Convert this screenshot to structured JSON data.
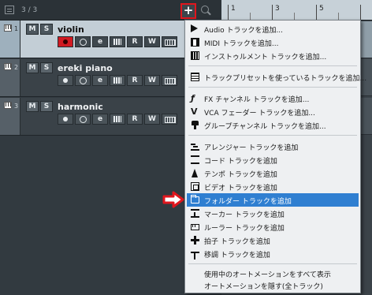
{
  "tracklist": {
    "count": "3 / 3",
    "add_button": "+",
    "tracks": [
      {
        "num": "1",
        "name": "violin",
        "m": "M",
        "s": "S",
        "btn_e": "e",
        "btn_r": "R",
        "btn_w": "W"
      },
      {
        "num": "2",
        "name": "ereki piano",
        "m": "M",
        "s": "S",
        "btn_e": "e",
        "btn_r": "R",
        "btn_w": "W"
      },
      {
        "num": "3",
        "name": "harmonic",
        "m": "M",
        "s": "S",
        "btn_e": "e",
        "btn_r": "R",
        "btn_w": "W"
      }
    ]
  },
  "ruler": {
    "bars": [
      "1",
      "3",
      "5"
    ]
  },
  "menu": {
    "items": [
      {
        "label": "Audio トラックを追加...",
        "icon": "audio-icon"
      },
      {
        "label": "MIDI トラックを追加...",
        "icon": "midi-icon"
      },
      {
        "label": "インストゥルメント トラックを追加...",
        "icon": "instrument-icon"
      },
      {
        "label": "トラックプリセットを使っているトラックを追加...",
        "icon": "preset-icon"
      },
      {
        "label": "FX チャンネル トラックを追加...",
        "icon": "fx-icon"
      },
      {
        "label": "VCA フェーダー トラックを追加...",
        "icon": "vca-icon"
      },
      {
        "label": "グループチャンネル トラックを追加...",
        "icon": "group-icon"
      },
      {
        "label": "アレンジャー トラックを追加",
        "icon": "arranger-icon"
      },
      {
        "label": "コード トラックを追加",
        "icon": "chord-icon"
      },
      {
        "label": "テンポ トラックを追加",
        "icon": "tempo-icon"
      },
      {
        "label": "ビデオ トラックを追加",
        "icon": "video-icon"
      },
      {
        "label": "フォルダー トラックを追加",
        "icon": "folder-icon",
        "highlighted": true
      },
      {
        "label": "マーカー トラックを追加",
        "icon": "marker-icon"
      },
      {
        "label": "ルーラー トラックを追加",
        "icon": "ruler-icon"
      },
      {
        "label": "拍子 トラックを追加",
        "icon": "signature-icon"
      },
      {
        "label": "移調 トラックを追加",
        "icon": "transpose-icon"
      },
      {
        "label": "使用中のオートメーションをすべて表示",
        "icon": ""
      },
      {
        "label": "オートメーションを隠す(全トラック)",
        "icon": ""
      }
    ]
  },
  "colors": {
    "highlight": "#2f7fd1",
    "annotation_red": "#e0161d",
    "selected_track": "#c3ced6",
    "record_enabled": "#d11a22"
  }
}
